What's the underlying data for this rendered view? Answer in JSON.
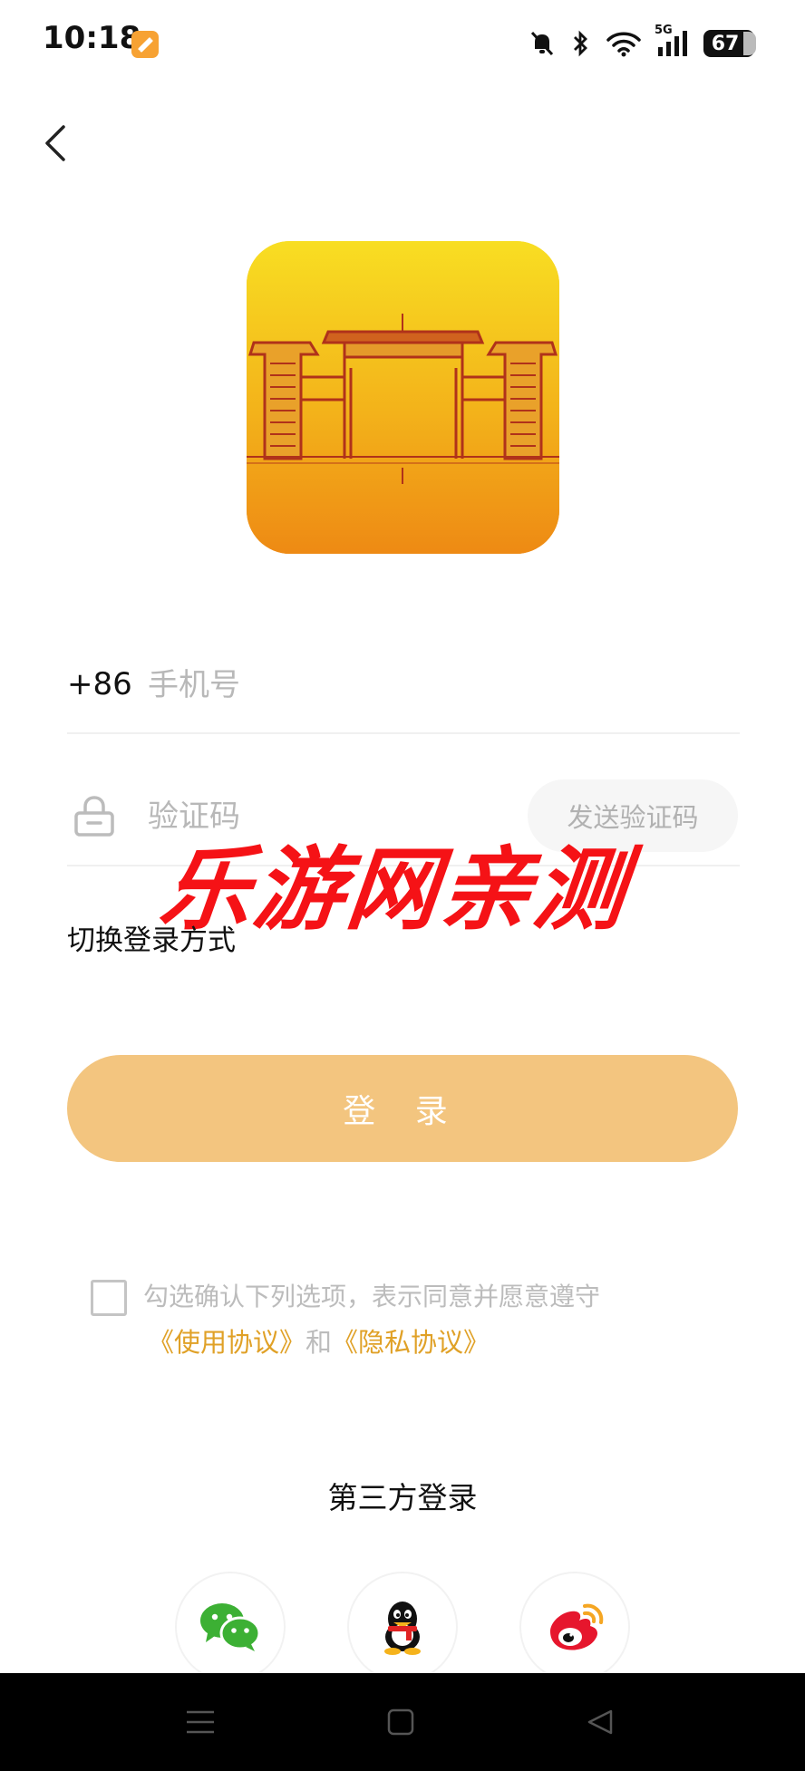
{
  "status_bar": {
    "time": "10:18",
    "battery": "67",
    "network": "5G",
    "icons": [
      "app-notification-icon",
      "mute-icon",
      "bluetooth-icon",
      "wifi-icon",
      "signal-icon",
      "battery-icon"
    ]
  },
  "login": {
    "country_code": "+86",
    "phone_placeholder": "手机号",
    "code_placeholder": "验证码",
    "send_code_label": "发送验证码",
    "switch_method_label": "切换登录方式",
    "login_button_label": "登 录"
  },
  "watermark": "乐游网亲测",
  "agreement": {
    "text": "勾选确认下列选项，表示同意并愿意遵守",
    "terms_link": "《使用协议》",
    "and_text": "和",
    "privacy_link": "《隐私协议》"
  },
  "third_party": {
    "title": "第三方登录",
    "providers": [
      "wechat-icon",
      "qq-icon",
      "weibo-icon"
    ]
  },
  "navigation": {
    "buttons": [
      "menu-icon",
      "home-icon",
      "back-triangle-icon"
    ]
  },
  "colors": {
    "accent": "#e0a127",
    "login_button": "#f3c57f",
    "watermark": "#f51216",
    "logo_top": "#f7d61a",
    "logo_bottom": "#f08d16"
  }
}
